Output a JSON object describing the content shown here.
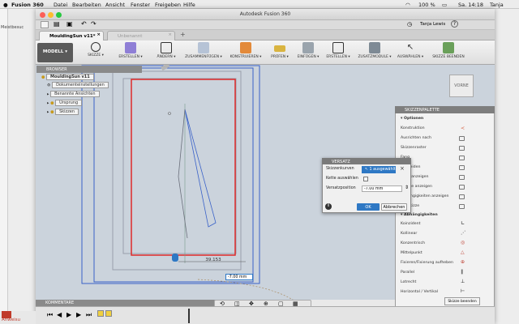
{
  "menubar": {
    "app": "Fusion 360",
    "items": [
      "Datei",
      "Bearbeiten",
      "Ansicht",
      "Fenster",
      "Freigeben",
      "Hilfe"
    ],
    "battery": "100 %",
    "clock": "Sa. 14:18",
    "user": "Tanja"
  },
  "window": {
    "title": "Autodesk Fusion 360",
    "user_label": "Tanja Lewis",
    "help_glyph": "?"
  },
  "tabs": [
    {
      "label": "MouldingSun v11*",
      "active": true
    },
    {
      "label": "Unbenannt",
      "active": false
    }
  ],
  "left_strip_text": "Meistbesuc",
  "bottom_left_text": "Anweisu",
  "ribbon": {
    "workspace": "MODELL",
    "buttons": [
      "SKIZZE",
      "ERSTELLEN",
      "ÄNDERN",
      "ZUSAMMENFÜGEN",
      "KONSTRUIEREN",
      "PRÜFEN",
      "EINFÜGEN",
      "ERSTELLEN",
      "ZUSATZMODULE",
      "AUSWÄHLEN",
      "SKIZZE BEENDEN"
    ]
  },
  "browser": {
    "title": "BROWSER",
    "root": "MouldingSun v11",
    "items": [
      "Dokumenteinstellungen",
      "Benannte Ansichten",
      "Ursprung",
      "Skizzen"
    ]
  },
  "viewcube": {
    "label": "VORNE"
  },
  "dimension_label": "39.153",
  "dimension_input": "-7.00 mm",
  "palette": {
    "title": "SKIZZENPALETTE",
    "section_options": "Optionen",
    "options": [
      "Konstruktion",
      "Ausrichten nach",
      "Skizzenraster",
      "Fang",
      "Schneiden",
      "Profil anzeigen",
      "Punkte anzeigen",
      "Abhängigkeiten anzeigen",
      "3D-Skizze"
    ],
    "section_constraints": "Abhängigkeiten",
    "constraints": [
      "Koinzident",
      "Kollinear",
      "Konzentrisch",
      "Mittelpunkt",
      "Fixieren/Fixierung aufheben",
      "Parallel",
      "Lotrecht",
      "Horizontal / Vertikal"
    ],
    "footer_button": "Skizze beenden"
  },
  "dialog": {
    "title": "VERSATZ",
    "label_curves": "Skizzenkurven",
    "selection": "1 ausgewählt",
    "label_chain": "Kette auswählen",
    "chain_checked": false,
    "label_offset": "Versatzposition",
    "offset_value": "-7.00 mm",
    "ok": "OK",
    "cancel": "Abbrechen",
    "close_glyph": "×",
    "info_glyph": "i"
  },
  "comments": {
    "label": "KOMMENTARE"
  },
  "colors": {
    "accent_blue": "#2e78c4",
    "rectangle_red": "#e02a2a",
    "sketch_blue": "#3a62c8",
    "canvas_bg": "#cbd3dc"
  }
}
